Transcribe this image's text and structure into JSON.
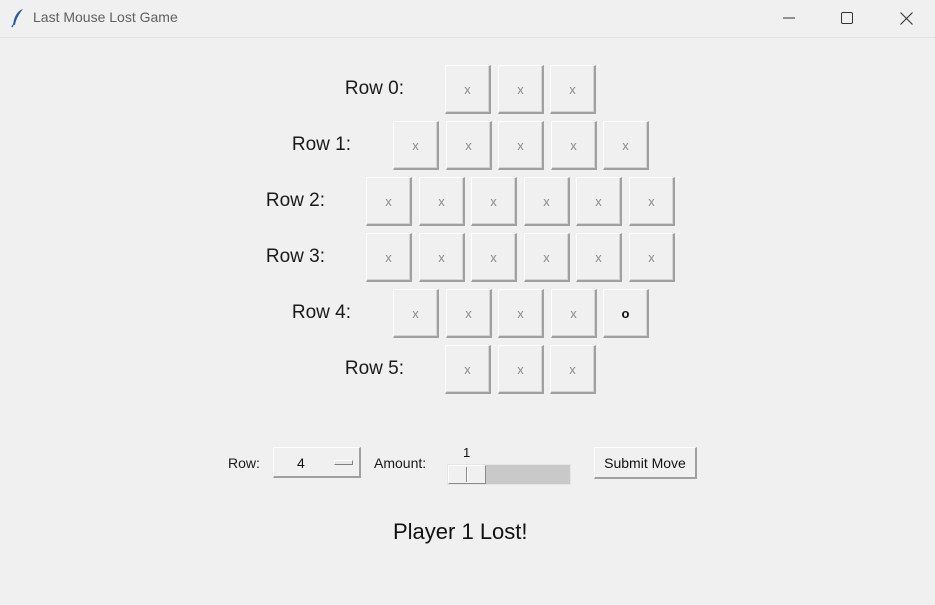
{
  "window": {
    "title": "Last Mouse Lost Game",
    "icon": "feather-icon",
    "controls": [
      "minimize-icon",
      "maximize-icon",
      "close-icon"
    ]
  },
  "board": {
    "rows": [
      {
        "label": "Row 0:",
        "cells": [
          "x",
          "x",
          "x"
        ]
      },
      {
        "label": "Row 1:",
        "cells": [
          "x",
          "x",
          "x",
          "x",
          "x"
        ]
      },
      {
        "label": "Row 2:",
        "cells": [
          "x",
          "x",
          "x",
          "x",
          "x",
          "x"
        ]
      },
      {
        "label": "Row 3:",
        "cells": [
          "x",
          "x",
          "x",
          "x",
          "x",
          "x"
        ]
      },
      {
        "label": "Row 4:",
        "cells": [
          "x",
          "x",
          "x",
          "x",
          "o"
        ]
      },
      {
        "label": "Row 5:",
        "cells": [
          "x",
          "x",
          "x"
        ]
      }
    ]
  },
  "controls": {
    "row_label": "Row:",
    "row_selected": "4",
    "amount_label": "Amount:",
    "amount_value": "1",
    "submit_label": "Submit Move"
  },
  "status": "Player 1 Lost!"
}
